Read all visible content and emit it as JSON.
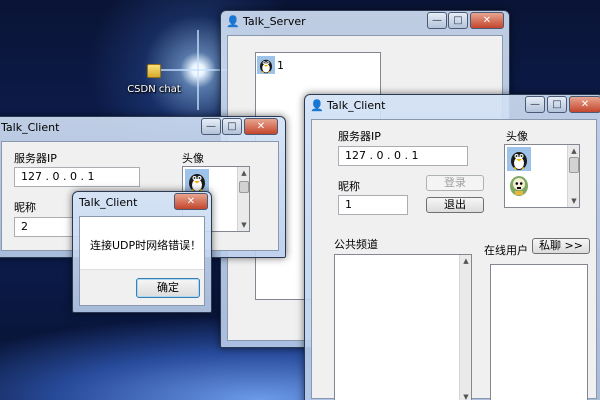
{
  "desktop": {
    "icon_label": "CSDN chat"
  },
  "server_window": {
    "title": "Talk_Server",
    "user_entry_text": "1",
    "controls": {
      "minimize": "—",
      "maximize": "□",
      "close": "✕"
    }
  },
  "client_window_back": {
    "title": "Talk_Client",
    "server_ip_label": "服务器IP",
    "ip_value": "127 . 0 . 0 . 1",
    "avatar_label": "头像",
    "nickname_label": "昵称",
    "nickname_value": "2",
    "controls": {
      "minimize": "—",
      "maximize": "□",
      "close": "✕"
    }
  },
  "error_dialog": {
    "title": "Talk_Client",
    "message": "连接UDP时网络错误！",
    "ok_button": "确定",
    "controls": {
      "close": "✕"
    }
  },
  "client_window_front": {
    "title": "Talk_Client",
    "server_ip_label": "服务器IP",
    "ip_value": "127 . 0 . 0 . 1",
    "avatar_label": "头像",
    "nickname_label": "昵称",
    "nickname_value": "1",
    "login_button": "登录",
    "logout_button": "退出",
    "public_channel_label": "公共频道",
    "online_users_label": "在线用户",
    "private_chat_button": "私聊 >>",
    "controls": {
      "minimize": "—",
      "maximize": "□",
      "close": "✕"
    }
  },
  "icons": [
    "folder-icon",
    "penguin-avatar-icon",
    "skull-avatar-icon",
    "app-icon"
  ],
  "colors": {
    "window_frame": "#bcd0ea",
    "client_bg": "#f0f0f0",
    "close_button": "#c4452c",
    "desktop_bg": "#0a1436"
  }
}
